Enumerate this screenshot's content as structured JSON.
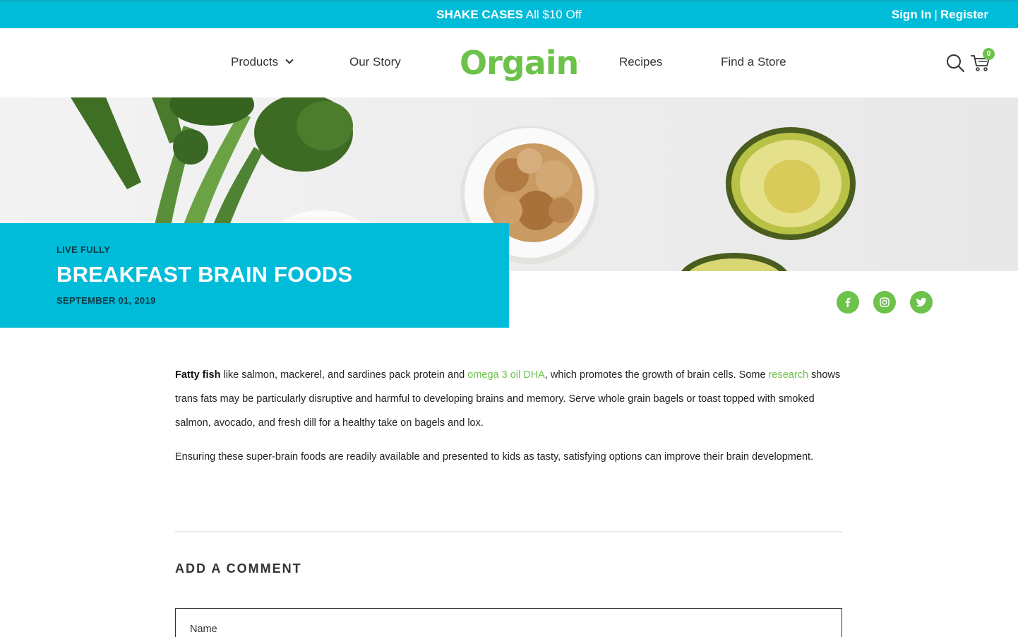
{
  "promo": {
    "highlight": "SHAKE CASES",
    "offer": "All $10 Off",
    "sign_in": "Sign In",
    "separator": "|",
    "register": "Register"
  },
  "header": {
    "nav": {
      "products": "Products",
      "our_story": "Our Story",
      "recipes": "Recipes",
      "find_store": "Find a Store"
    },
    "logo": "Orgain",
    "cart_count": "0"
  },
  "post": {
    "category": "LIVE FULLY",
    "title": "BREAKFAST BRAIN FOODS",
    "date": "SEPTEMBER 01, 2019"
  },
  "social": [
    "facebook-icon",
    "instagram-icon",
    "twitter-icon"
  ],
  "article": {
    "p1": {
      "bold": "Fatty fish",
      "t1": " like salmon, mackerel, and sardines pack protein and ",
      "link1": "omega 3 oil DHA",
      "t2": ", which promotes the growth of brain cells. Some ",
      "link2": "research",
      "t3": " shows trans fats may be particularly disruptive and harmful to developing brains and memory. Serve whole grain bagels or toast topped with smoked salmon, avocado, and fresh dill for a healthy take on bagels and lox."
    },
    "p2": "Ensuring these super-brain foods are readily available and presented to kids as tasty, satisfying options can improve their brain development."
  },
  "comment": {
    "heading": "ADD A COMMENT",
    "name_placeholder": "Name"
  },
  "colors": {
    "accent_blue": "#00bcd9",
    "brand_green": "#6cc24a"
  }
}
